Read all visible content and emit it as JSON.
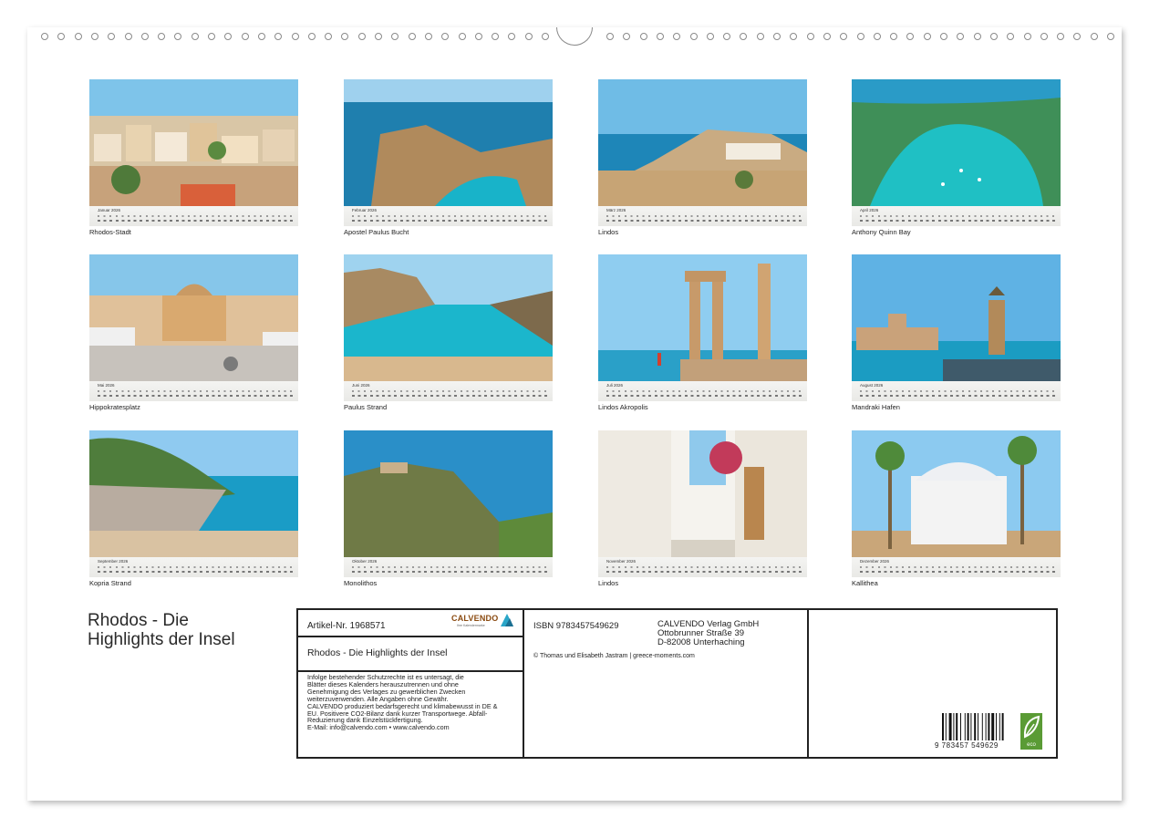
{
  "months": [
    {
      "label": "Januar 2026",
      "caption": "Rhodos-Stadt"
    },
    {
      "label": "Februar 2026",
      "caption": "Apostel Paulus Bucht"
    },
    {
      "label": "März 2026",
      "caption": "Lindos"
    },
    {
      "label": "April 2026",
      "caption": "Anthony Quinn Bay"
    },
    {
      "label": "Mai 2026",
      "caption": "Hippokratesplatz"
    },
    {
      "label": "Juni 2026",
      "caption": "Paulus Strand"
    },
    {
      "label": "Juli 2026",
      "caption": "Lindos Akropolis"
    },
    {
      "label": "August 2026",
      "caption": "Mandraki Hafen"
    },
    {
      "label": "September 2026",
      "caption": "Kopria Strand"
    },
    {
      "label": "Oktober 2026",
      "caption": "Monolithos"
    },
    {
      "label": "November 2026",
      "caption": "Lindos"
    },
    {
      "label": "Dezember 2026",
      "caption": "Kallithea"
    }
  ],
  "title_line1": "Rhodos - Die",
  "title_line2": "Highlights der Insel",
  "info": {
    "article_number": "Artikel-Nr. 1968571",
    "brand": "CALVENDO",
    "brand_tagline": "Ihre Kalendermarke",
    "subtitle": "Rhodos - Die Highlights der Insel",
    "legal_lines": [
      "Infolge bestehender Schutzrechte ist es untersagt, die",
      "Blätter dieses Kalenders herauszutrennen und ohne",
      "Genehmigung des Verlages zu gewerblichen Zwecken",
      "weiterzuverwenden. Alle Angaben ohne Gewähr.",
      "CALVENDO produziert bedarfsgerecht und klimabewusst in DE &",
      "EU. Positivere CO2-Bilanz dank kurzer Transportwege. Abfall-",
      "Reduzierung dank Einzelstückfertigung.",
      "E-Mail: info@calvendo.com • www.calvendo.com"
    ],
    "isbn": "ISBN 9783457549629",
    "publisher_lines": [
      "CALVENDO Verlag GmbH",
      "Ottobrunner Straße 39",
      "D-82008 Unterhaching"
    ],
    "copyright": "© Thomas und Elisabeth Jastram | greece-moments.com",
    "barcode_number": "9 783457 549629",
    "eco_label": "eco"
  },
  "colors": {
    "sky": "#5cb3e0",
    "sea": "#1aa6c4",
    "rock": "#c09a6b",
    "brand": "#8a4a10",
    "eco": "#5a9b35"
  }
}
